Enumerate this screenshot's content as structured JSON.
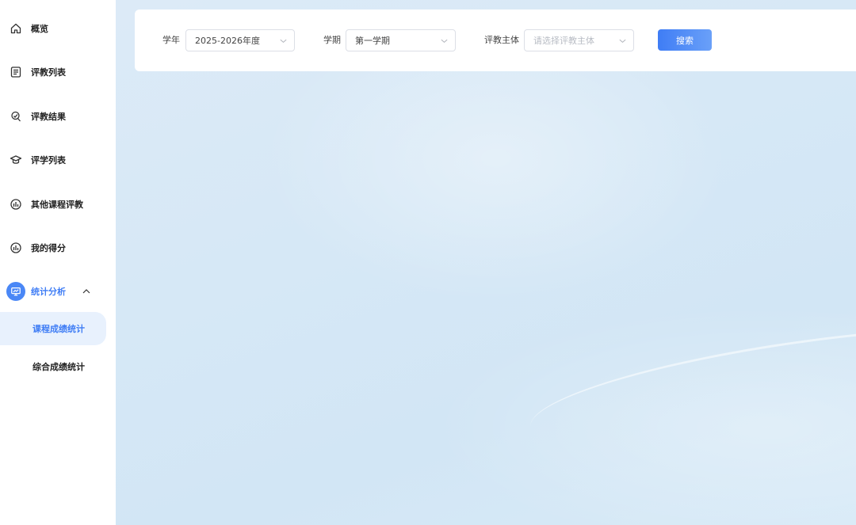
{
  "sidebar": {
    "items": [
      {
        "label": "概览",
        "icon": "home-icon"
      },
      {
        "label": "评教列表",
        "icon": "list-icon"
      },
      {
        "label": "评教结果",
        "icon": "result-icon"
      },
      {
        "label": "评学列表",
        "icon": "graduation-cap-icon"
      },
      {
        "label": "其他课程评教",
        "icon": "chart-circle-icon"
      },
      {
        "label": "我的得分",
        "icon": "chart-circle-icon"
      },
      {
        "label": "统计分析",
        "icon": "presentation-icon"
      }
    ],
    "submenu": [
      {
        "label": "课程成绩统计",
        "selected": true
      },
      {
        "label": "综合成绩统计",
        "selected": false
      }
    ]
  },
  "filters": {
    "year_label": "学年",
    "year_value": "2025-2026年度",
    "term_label": "学期",
    "term_value": "第一学期",
    "subject_label": "评教主体",
    "subject_placeholder": "请选择评教主体",
    "search_label": "搜索"
  },
  "colors": {
    "accent": "#3f7df5",
    "selected_bg": "#e8f1fd",
    "main_bg": "#d6e8f6"
  }
}
